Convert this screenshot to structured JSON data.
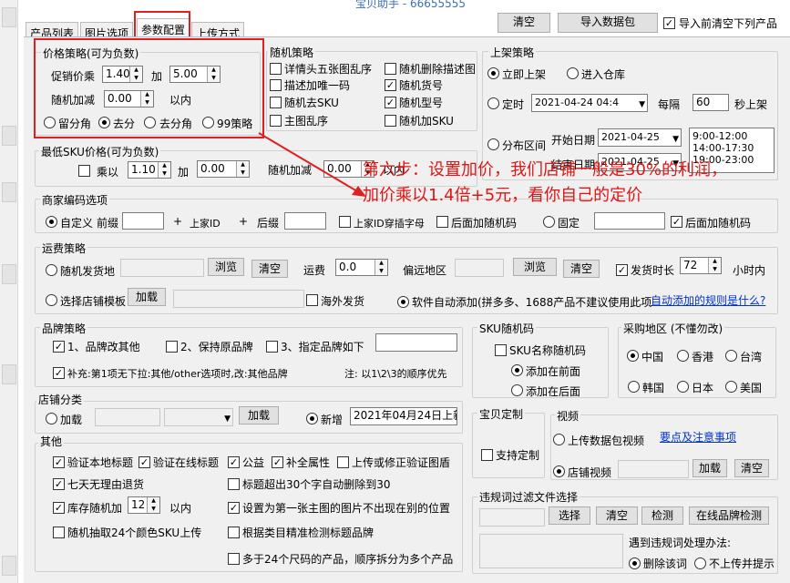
{
  "window": {
    "title_partial": "宝贝助手 - 66655555"
  },
  "top_buttons": {
    "clear": "清空",
    "import": "导入数据包",
    "clear_before_import": "导入前清空下列产品",
    "clear_before_import_checked": true
  },
  "tabs": [
    {
      "label": "产品列表"
    },
    {
      "label": "图片选项"
    },
    {
      "label": "参数配置",
      "active": true
    },
    {
      "label": "上传方式"
    }
  ],
  "price_strategy": {
    "title": "价格策略(可为负数)",
    "multiplier_label": "促销价乘",
    "multiplier_value": "1.40",
    "add_label": "加",
    "add_value": "5.00",
    "random_label": "随机加减",
    "random_value": "0.00",
    "within_label": "以内",
    "rounding": [
      {
        "label": "留分角",
        "selected": false
      },
      {
        "label": "去分",
        "selected": true
      },
      {
        "label": "去分角",
        "selected": false
      },
      {
        "label": "99策略",
        "selected": false
      }
    ]
  },
  "min_sku_price": {
    "title": "最低SKU价格(可为负数)",
    "multiply_label": "乘以",
    "multiply_checked": false,
    "multiply_value": "1.10",
    "add_label": "加",
    "add_value": "0.00",
    "random_label": "随机加减",
    "random_value": "0.00",
    "within_label": "以内"
  },
  "random_strategy": {
    "title": "随机策略",
    "items": [
      {
        "label": "详情头五张图乱序",
        "checked": false
      },
      {
        "label": "随机删除描述图",
        "checked": false
      },
      {
        "label": "描述加唯一码",
        "checked": false
      },
      {
        "label": "随机货号",
        "checked": true
      },
      {
        "label": "随机去SKU",
        "checked": false
      },
      {
        "label": "随机型号",
        "checked": true
      },
      {
        "label": "主图乱序",
        "checked": false
      },
      {
        "label": "随机加SKU",
        "checked": false
      }
    ]
  },
  "listing_strategy": {
    "title": "上架策略",
    "immediate": "立即上架",
    "warehouse": "进入仓库",
    "timed": "定时",
    "timed_value": "2021-04-24 04:4",
    "interval_label": "每隔",
    "interval_value": "60",
    "interval_unit": "秒上架",
    "range_label": "分布区间",
    "start_label": "开始日期",
    "start_value": "2021-04-25",
    "end_label": "结束日期",
    "end_value": "2021-04-25",
    "time_slots": [
      "9:00-12:00",
      "14:00-17:30",
      "19:00-23:00"
    ]
  },
  "annotation": {
    "line1": "第六步：设置加价，我们店铺一般是30%的利润，",
    "line2": "加价乘以1.4倍+5元，看你自己的定价"
  },
  "merchant_code": {
    "title": "商家编码选项",
    "custom": "自定义",
    "prefix": "前缀",
    "plus1": "+",
    "item_id": "上家ID",
    "plus2": "+",
    "suffix": "后缀",
    "id_pinyin": "上家ID穿插字母",
    "append_random": "后面加随机码",
    "fixed": "固定",
    "append_random2": "后面加随机码",
    "append_random2_checked": true
  },
  "shipping": {
    "title": "运费策略",
    "random_origin": "随机发货地",
    "browse": "浏览",
    "clear": "清空",
    "freight_label": "运费",
    "freight_value": "0.0",
    "remote_label": "偏远地区",
    "browse2": "浏览",
    "clear2": "清空",
    "ship_time": "发货时长",
    "ship_time_value": "72",
    "ship_time_unit": "小时内",
    "template": "选择店铺模板",
    "load": "加载",
    "overseas": "海外发货",
    "auto_add": "软件自动添加(拼多多、1688产品不建议使用此项",
    "auto_rules_link": "自动添加的规则是什么?"
  },
  "brand": {
    "title": "品牌策略",
    "opt1": "1、品牌改其他",
    "opt2": "2、保持原品牌",
    "opt3": "3、指定品牌如下",
    "note_label": "补充:第1项无下拉:其他/other选项时,改:其他品牌",
    "note2": "注: 以1\\2\\3的顺序优先"
  },
  "sku_random": {
    "title": "SKU随机码",
    "name_random": "SKU名称随机码",
    "front": "添加在前面",
    "back": "添加在后面"
  },
  "purchase_region": {
    "title": "采购地区 (不懂勿改)",
    "regions": [
      {
        "label": "中国",
        "selected": true
      },
      {
        "label": "香港",
        "selected": false
      },
      {
        "label": "台湾",
        "selected": false
      },
      {
        "label": "韩国",
        "selected": false
      },
      {
        "label": "日本",
        "selected": false
      },
      {
        "label": "美国",
        "selected": false
      }
    ]
  },
  "shop_category": {
    "title": "店铺分类",
    "load": "加载",
    "load_btn": "加载",
    "new": "新增",
    "new_value": "2021年04月24日上新"
  },
  "baby_custom": {
    "title": "宝贝定制",
    "support": "支持定制"
  },
  "video": {
    "title": "视频",
    "upload": "上传数据包视频",
    "notes_link": "要点及注意事项",
    "shop_video": "店铺视频",
    "load": "加载",
    "clear": "清空"
  },
  "other": {
    "title": "其他",
    "items": [
      {
        "label": "验证本地标题",
        "checked": true
      },
      {
        "label": "验证在线标题",
        "checked": true
      },
      {
        "label": "公益",
        "checked": true
      },
      {
        "label": "补全属性",
        "checked": true
      },
      {
        "label": "上传或修正验证图盾",
        "checked": false
      },
      {
        "label": "七天无理由退货",
        "checked": true
      },
      {
        "label": "标题超出30个字自动删除到30",
        "checked": false
      },
      {
        "label": "库存随机加",
        "checked": true
      },
      {
        "label": "设置为第一张主图的图片不出现在别的位置",
        "checked": true
      },
      {
        "label": "随机抽取24个颜色SKU上传",
        "checked": false
      },
      {
        "label": "根据类目精准检测标题品牌",
        "checked": false
      },
      {
        "label": "多于24个尺码的产品，顺序拆分为多个产品",
        "checked": false
      }
    ],
    "stock_value": "12",
    "stock_within": "以内"
  },
  "violation": {
    "title": "违规词过滤文件选择",
    "choose": "选择",
    "clear": "清空",
    "detect": "检测",
    "brand_check": "在线品牌检测",
    "handle_label": "遇到违规词处理办法:",
    "delete": "删除该词",
    "skip": "不上传并提示"
  }
}
